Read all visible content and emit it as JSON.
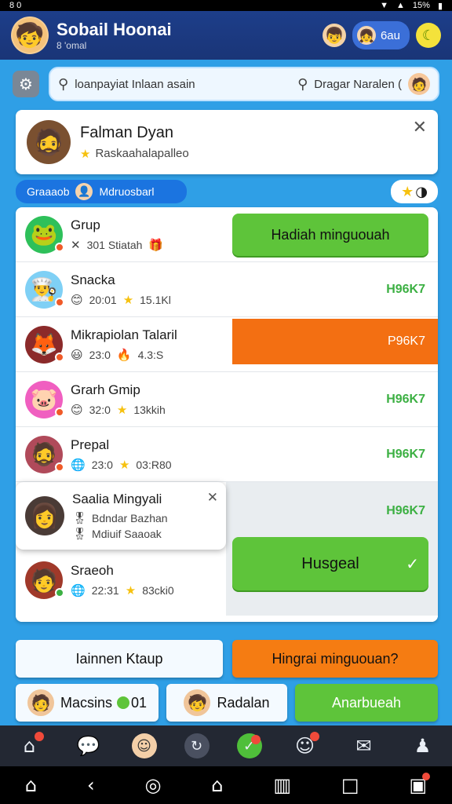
{
  "status": {
    "left": "8 0",
    "right_text": "15%"
  },
  "header": {
    "title": "Sobail Hoonai",
    "subtitle": "8 'omal",
    "pill_label": "6au"
  },
  "search": {
    "value": "loanpayiat Inlaan asain",
    "right_text": "Dragar Naralen ("
  },
  "profile": {
    "name": "Falman Dyan",
    "subtitle": "Raskaahalapalleo"
  },
  "section": {
    "tab_left": "Graaaob",
    "tab_right": "Mdruosbarl"
  },
  "rows": [
    {
      "name": "Grup",
      "meta1": "301 Stiatah",
      "meta2": "",
      "score": "",
      "action": "Hadiah minguouah"
    },
    {
      "name": "Snacka",
      "meta1": "20:01",
      "meta2": "15.1Kl",
      "score": "H96K7",
      "action": ""
    },
    {
      "name": "Mikrapiolan Talaril",
      "meta1": "23:0",
      "meta2": "4.3:S",
      "score": "",
      "action": "P96K7"
    },
    {
      "name": "Grarh Gmip",
      "meta1": "32:0",
      "meta2": "13kkih",
      "score": "H96K7",
      "action": ""
    },
    {
      "name": "Prepal",
      "meta1": "23:0",
      "meta2": "03:R80",
      "score": "H96K7",
      "action": ""
    },
    {
      "name": "Saalia Mingyali",
      "meta1": "Bdndar Bazhan",
      "meta2": "Mdiuif Saaoak",
      "score": "H96K7",
      "action": ""
    },
    {
      "name": "Sraeoh",
      "meta1": "22:31",
      "meta2": "83cki0",
      "score": "",
      "action": "Husgeal"
    }
  ],
  "actions": {
    "left": "Iainnen Ktaup",
    "right": "Hingrai minguouan?",
    "user1_label": "Macsins",
    "user1_count": "01",
    "user2_label": "Radalan",
    "green": "Anarbueah"
  },
  "colors": {
    "header_bg": "#1d3e8a",
    "accent_blue": "#1b74e0",
    "green": "#5ec43a",
    "orange": "#f36f12",
    "score_green": "#3cb043"
  },
  "icons": {
    "tabbar": [
      "home-icon",
      "chat-icon",
      "face-icon",
      "refresh-icon",
      "bell-icon",
      "robot-icon",
      "mail-icon",
      "person-icon"
    ],
    "navbar": [
      "home-icon",
      "back-icon",
      "circle-icon",
      "house-icon",
      "pages-icon",
      "square-icon",
      "bag-icon"
    ]
  }
}
